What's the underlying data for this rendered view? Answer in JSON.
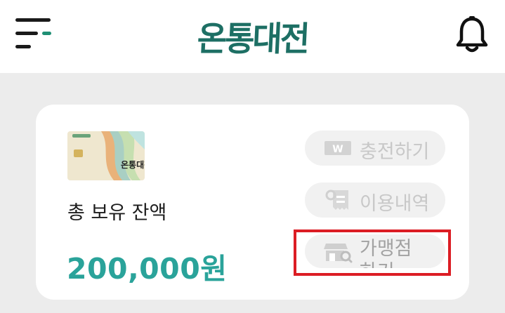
{
  "header": {
    "logo_text": "온통대전",
    "menu_icon": "menu-icon",
    "bell_icon": "bell-icon",
    "accent_color": "#1f8f74"
  },
  "card": {
    "balance_label": "총 보유 잔액",
    "balance_amount": "200,000원",
    "balance_color": "#2aa39a",
    "thumbnail_logo": "온통대전",
    "actions": [
      {
        "label": "충전하기",
        "icon": "won-icon"
      },
      {
        "label": "이용내역",
        "icon": "receipt-icon"
      },
      {
        "label": "가맹점하기",
        "icon": "store-search-icon"
      }
    ]
  },
  "highlight_color": "#dc1d24"
}
